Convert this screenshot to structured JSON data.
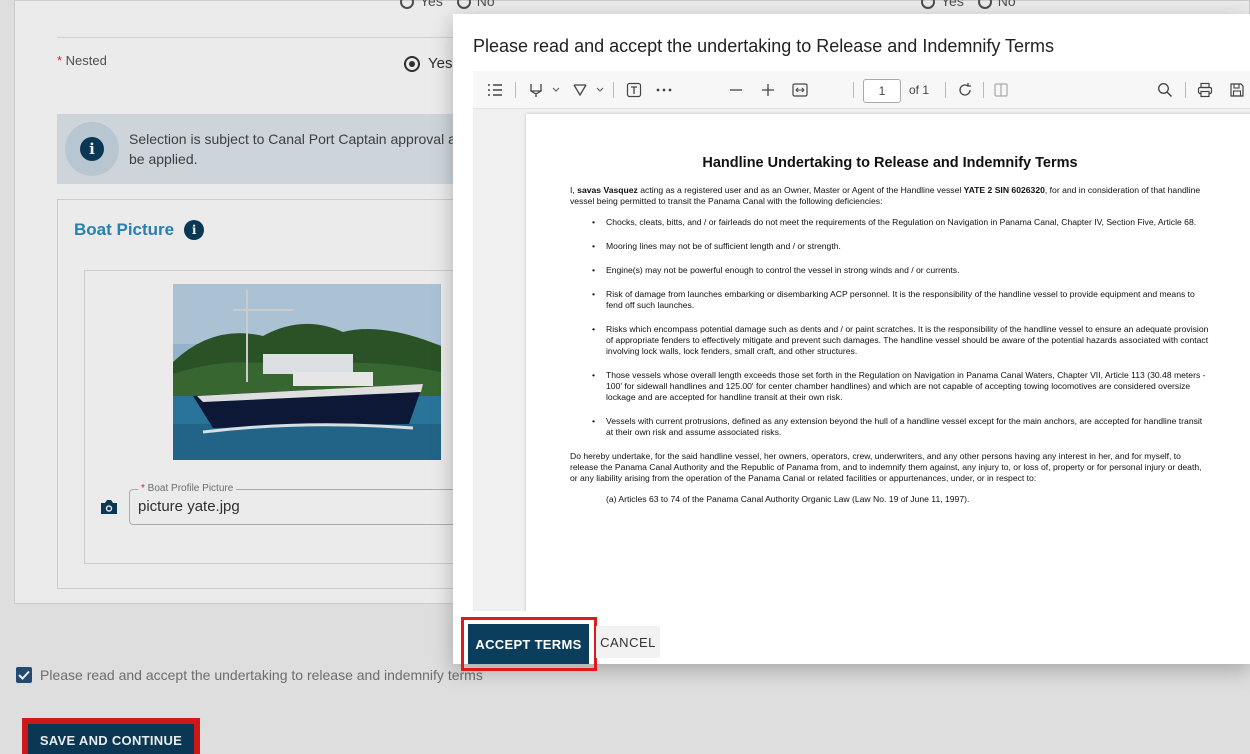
{
  "form": {
    "prev_yes": "Yes",
    "prev_no": "No",
    "nested_label": "Nested",
    "nested_yes": "Yes",
    "info_text": "Selection is subject to Canal Port Captain approval and may be applied.",
    "info_line1": "Selection is subject to Canal Port Captain approval ar",
    "info_line2": "be applied.",
    "picture_title": "Boat Picture",
    "file_label": "Boat Profile Picture",
    "file_value": "picture yate.jpg",
    "terms_checkbox": "Please read and accept the undertaking to release and indemnify terms",
    "save_button": "SAVE AND CONTINUE"
  },
  "modal": {
    "title": "Please read and accept the undertaking to Release and Indemnify Terms",
    "toolbar": {
      "page_current": "1",
      "page_of": "of 1"
    },
    "document": {
      "heading": "Handline Undertaking to Release and Indemnify Terms",
      "intro_prefix": "I, ",
      "name": "savas Vasquez",
      "intro_mid": " acting as a registered user and as an Owner, Master or Agent of the Handline vessel ",
      "vessel": "YATE 2  SIN 6026320",
      "intro_suffix": ", for and in consideration of that handline vessel being permitted to transit the Panama Canal with the following deficiencies:",
      "bullets": [
        "Chocks, cleats, bitts, and / or fairleads do not meet the requirements of the Regulation on Navigation in Panama Canal, Chapter IV, Section Five, Article 68.",
        "Mooring lines may not be of sufficient length and / or strength.",
        "Engine(s) may not be powerful enough to control the vessel in strong winds and / or currents.",
        "Risk of damage from launches embarking or disembarking ACP personnel. It is the responsibility of the handline vessel to provide equipment and means to fend off such launches.",
        "Risks which encompass potential damage such as dents and / or paint scratches. It is the responsibility of the handline vessel to ensure an adequate provision of appropriate fenders to effectively mitigate and prevent such damages. The handline vessel should be aware of the potential hazards associated with contact involving lock walls, lock fenders, small craft, and other structures.",
        "Those vessels whose overall length exceeds those set forth in the Regulation on Navigation in Panama Canal Waters, Chapter VII, Article 113 (30.48 meters - 100' for sidewall handlines and 125.00' for center chamber handlines) and which are not capable of accepting towing locomotives are considered oversize lockage and are accepted for handline transit at their own risk.",
        "Vessels with current protrusions, defined as any extension beyond the hull of a handline vessel except for the main anchors, are accepted for handline transit at their own risk and assume associated risks."
      ],
      "undertake": "Do hereby undertake, for the said handline vessel, her owners, operators, crew, underwriters, and any other persons having any interest in her, and for myself, to release the Panama Canal Authority and the Republic of Panama from, and to indemnify them against, any injury to, or loss of, property or for personal injury or death, or any liability arising from the operation of the Panama Canal or related facilities or appurtenances, under, or in respect to:",
      "clause_a": "(a) Articles 63 to 74 of the Panama Canal Authority Organic Law (Law No. 19 of June 11, 1997)."
    },
    "accept_button": "ACCEPT TERMS",
    "cancel_button": "CANCEL"
  },
  "colors": {
    "primary": "#0b3d5c",
    "highlight": "#e0191b",
    "title_blue": "#2a8dbd"
  }
}
